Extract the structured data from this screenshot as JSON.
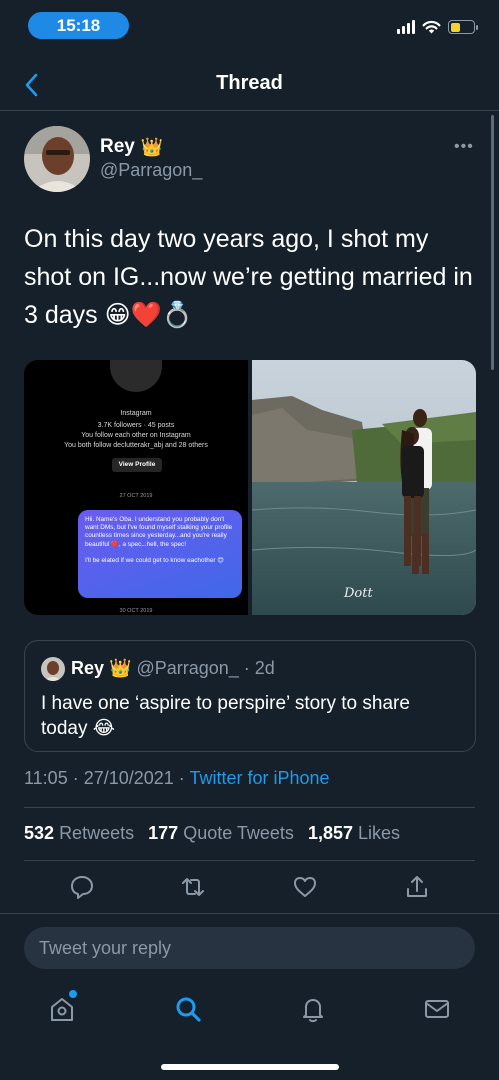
{
  "status_bar": {
    "time": "15:18",
    "icons": [
      "signal-icon",
      "wifi-icon",
      "battery-icon"
    ],
    "battery_level": 0.45,
    "colors": {
      "time_pill": "#1e8ae6",
      "battery": "#f7d12e"
    }
  },
  "header": {
    "title": "Thread",
    "back_icon": "chevron-left-icon"
  },
  "tweet": {
    "author_name": "Rey",
    "author_badge": "👑",
    "handle": "@Parragon_",
    "more_icon": "more-icon",
    "text": "On this day two years ago, I shot my shot on IG...now we’re getting married in 3 days 😁❤️💍",
    "timestamp": "11:05 · 27/10/2021 · ",
    "source": "Twitter for iPhone"
  },
  "media": {
    "screenshot": {
      "ig_label": "Instagram",
      "ig_stats": "3.7K followers · 45 posts",
      "ig_follow": "You follow each other on Instagram",
      "ig_mutual": "You both follow declutterakr_abj and 28 others",
      "view_profile": "View Profile",
      "date": "27 OCT 2019",
      "message": "Hii. Name's Oba. I understand you probably don't want DMs, but I've found myself stalking your profile countless times since yesterday...and you're really beautiful ❤️, a spec...hell, the spec!",
      "message_2": "I'll be elated if we could get to know eachother 😊",
      "date_2": "30 OCT 2019"
    },
    "photo": {
      "watermark": "Dott"
    }
  },
  "quote": {
    "author_name": "Rey",
    "author_badge": "👑",
    "handle": "@Parragon_",
    "age": "· 2d",
    "text": "I have one ‘aspire to perspire’ story to share today 😂"
  },
  "stats": [
    {
      "count": "532",
      "label": "Retweets"
    },
    {
      "count": "177",
      "label": "Quote Tweets"
    },
    {
      "count": "1,857",
      "label": "Likes"
    }
  ],
  "actions": [
    "reply-icon",
    "retweet-icon",
    "like-icon",
    "share-icon"
  ],
  "reply_box": {
    "placeholder": "Tweet your reply"
  },
  "tab_bar": {
    "tabs": [
      "home-icon",
      "search-icon",
      "notifications-icon",
      "messages-icon"
    ],
    "active": "search-icon",
    "accent": "#1d9bf0"
  }
}
